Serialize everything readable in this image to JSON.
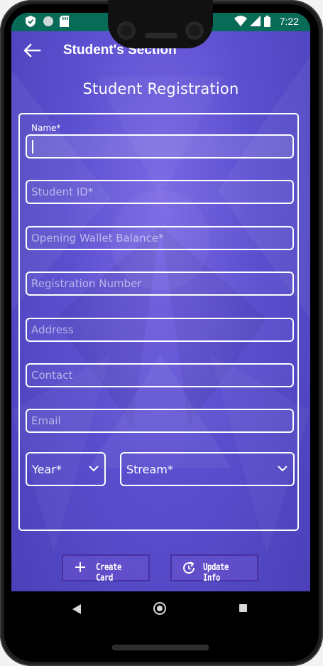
{
  "status_bar": {
    "time": "7:22",
    "icons_left": [
      "shield-icon",
      "circle-icon",
      "sd-card-icon"
    ],
    "icons_right": [
      "wifi-icon",
      "signal-icon",
      "battery-icon"
    ],
    "color": "#086b57"
  },
  "app_bar": {
    "title": "Student's Section",
    "back_icon": "arrow-left-icon"
  },
  "page": {
    "title": "Student Registration"
  },
  "form": {
    "name": {
      "label": "Name*",
      "value": ""
    },
    "student_id": {
      "placeholder": "Student ID*"
    },
    "opening_wallet_balance": {
      "placeholder": "Opening Wallet Balance*"
    },
    "registration_number": {
      "placeholder": "Registration Number"
    },
    "address": {
      "placeholder": "Address"
    },
    "contact": {
      "placeholder": "Contact"
    },
    "email": {
      "placeholder": "Email"
    },
    "year": {
      "label": "Year*"
    },
    "stream": {
      "label": "Stream*"
    }
  },
  "actions": {
    "create_card": {
      "label": "Create Card",
      "icon": "plus-icon"
    },
    "update_info": {
      "label": "Update Info",
      "icon": "refresh-icon"
    }
  },
  "nav_bar": {
    "back_icon": "triangle-back-icon",
    "home_icon": "circle-home-icon",
    "recents_icon": "square-recents-icon"
  },
  "theme": {
    "background": "#5b4fcf",
    "accent": "#ffffff"
  }
}
